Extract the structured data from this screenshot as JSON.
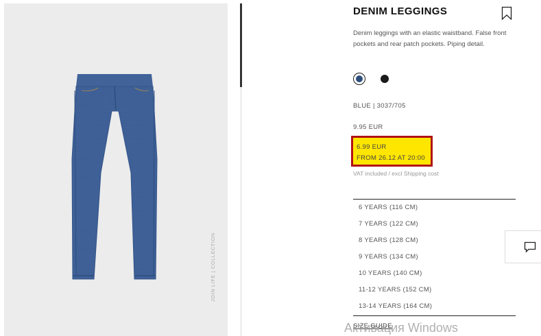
{
  "product": {
    "title": "DENIM LEGGINGS",
    "description": "Denim leggings with an elastic waistband. False front pockets and rear patch pockets. Piping detail.",
    "color_ref": "BLUE | 3037/705",
    "old_price": "9.95 EUR",
    "promo_price": "6.99 EUR",
    "promo_date": "FROM 26.12 AT 20:00",
    "vat_note": "VAT included / excl Shipping cost",
    "size_guide": "SIZE GUIDE"
  },
  "image": {
    "collection_tag": "JOIN LIFE | COLLECTION"
  },
  "colors": [
    {
      "name": "blue",
      "hex": "#2f4f7a",
      "selected": true
    },
    {
      "name": "black",
      "hex": "#1b1b1b",
      "selected": false
    }
  ],
  "sizes": [
    "6 YEARS (116 CM)",
    "7 YEARS (122 CM)",
    "8 YEARS (128 CM)",
    "9 YEARS (134 CM)",
    "10 YEARS (140 CM)",
    "11-12 YEARS (152 CM)",
    "13-14 YEARS (164 CM)"
  ],
  "icons": {
    "bookmark": "bookmark-icon",
    "chat": "chat-icon"
  },
  "theme": {
    "promo_bg": "#ffe600",
    "promo_border": "#b01116",
    "denim": "#3d5f95"
  },
  "os_watermark": "Активация Windows"
}
